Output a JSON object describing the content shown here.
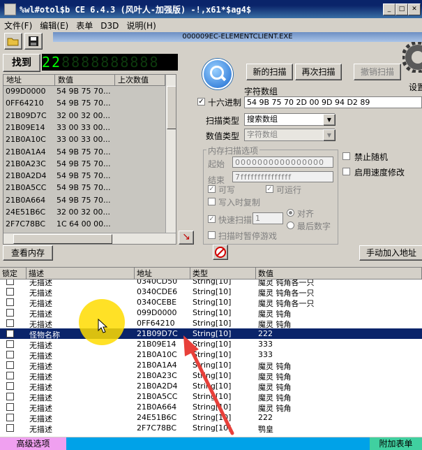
{
  "window": {
    "title": "%wl#otol$b  CE 6.4.3 (风叶人-加强版)  -!,x61*$ag4$"
  },
  "menu": [
    "文件(F)",
    "编辑(E)",
    "表单",
    "D3D",
    "说明(H)"
  ],
  "process": "000009EC-ELEMENTCLIENT.EXE",
  "found": {
    "label": "找到",
    "count": "22"
  },
  "found_headers": {
    "addr": "地址",
    "value": "数值",
    "prev": "上次数值"
  },
  "found_rows": [
    {
      "addr": "099D0000",
      "val": "54 9B 75 70..."
    },
    {
      "addr": "0FF64210",
      "val": "54 9B 75 70..."
    },
    {
      "addr": "21B09D7C",
      "val": "32 00 32 00..."
    },
    {
      "addr": "21B09E14",
      "val": "33 00 33 00..."
    },
    {
      "addr": "21B0A10C",
      "val": "33 00 33 00..."
    },
    {
      "addr": "21B0A1A4",
      "val": "54 9B 75 70..."
    },
    {
      "addr": "21B0A23C",
      "val": "54 9B 75 70..."
    },
    {
      "addr": "21B0A2D4",
      "val": "54 9B 75 70..."
    },
    {
      "addr": "21B0A5CC",
      "val": "54 9B 75 70..."
    },
    {
      "addr": "21B0A664",
      "val": "54 9B 75 70..."
    },
    {
      "addr": "24E51B6C",
      "val": "32 00 32 00..."
    },
    {
      "addr": "2F7C78BC",
      "val": "1C 64 00 00..."
    }
  ],
  "buttons": {
    "new_scan": "新的扫描",
    "next_scan": "再次扫描",
    "undo_scan": "撤销扫描",
    "settings": "设置",
    "view_memory": "查看内存",
    "add_manual": "手动加入地址"
  },
  "scan": {
    "hex_label": "十六进制",
    "value_label": "字符数组",
    "value": "54 9B 75 70 2D 00 9D 94 D2 89",
    "scan_type_label": "扫描类型",
    "scan_type": "搜索数组",
    "value_type_label": "数值类型",
    "value_type": "字符数组",
    "mem_options": "内存扫描选项",
    "start_label": "起始",
    "start": "0000000000000000",
    "end_label": "结束",
    "end": "7fffffffffffffff",
    "writable": "可写",
    "executable": "可运行",
    "copy_on_write": "写入时复制",
    "fast_scan": "快速扫描",
    "fast_value": "1",
    "align": "对齐",
    "last_digits": "最后数字",
    "pause": "扫描时暂停游戏",
    "no_random": "禁止随机",
    "speedhack": "启用速度修改"
  },
  "table_headers": {
    "lock": "锁定",
    "desc": "描述",
    "addr": "地址",
    "type": "类型",
    "value": "数值"
  },
  "table_rows": [
    {
      "desc": "无描述",
      "addr": "0340CD50",
      "type": "String[10]",
      "val": "魔灵 钝角各一只",
      "sel": false
    },
    {
      "desc": "无描述",
      "addr": "0340CDE6",
      "type": "String[10]",
      "val": "魔灵 钝角各一只",
      "sel": false
    },
    {
      "desc": "无描述",
      "addr": "0340CEBE",
      "type": "String[10]",
      "val": "魔灵 钝角各一只",
      "sel": false
    },
    {
      "desc": "无描述",
      "addr": "099D0000",
      "type": "String[10]",
      "val": "魔灵 钝角",
      "sel": false
    },
    {
      "desc": "无描述",
      "addr": "0FF64210",
      "type": "String[10]",
      "val": "魔灵 钝角",
      "sel": false
    },
    {
      "desc": "怪物名称",
      "addr": "21B09D7C",
      "type": "String[10]",
      "val": "222",
      "sel": true
    },
    {
      "desc": "无描述",
      "addr": "21B09E14",
      "type": "String[10]",
      "val": "333",
      "sel": false
    },
    {
      "desc": "无描述",
      "addr": "21B0A10C",
      "type": "String[10]",
      "val": "333",
      "sel": false
    },
    {
      "desc": "无描述",
      "addr": "21B0A1A4",
      "type": "String[10]",
      "val": "魔灵 钝角",
      "sel": false
    },
    {
      "desc": "无描述",
      "addr": "21B0A23C",
      "type": "String[10]",
      "val": "魔灵 钝角",
      "sel": false
    },
    {
      "desc": "无描述",
      "addr": "21B0A2D4",
      "type": "String[10]",
      "val": "魔灵 钝角",
      "sel": false
    },
    {
      "desc": "无描述",
      "addr": "21B0A5CC",
      "type": "String[10]",
      "val": "魔灵 钝角",
      "sel": false
    },
    {
      "desc": "无描述",
      "addr": "21B0A664",
      "type": "String[10]",
      "val": "魔灵 钝角",
      "sel": false
    },
    {
      "desc": "无描述",
      "addr": "24E51B6C",
      "type": "String[10]",
      "val": "222",
      "sel": false
    },
    {
      "desc": "无描述",
      "addr": "2F7C78BC",
      "type": "String[10]",
      "val": "鹗皇",
      "sel": false
    }
  ],
  "bottom": {
    "advanced": "高级选项",
    "append": "附加表单"
  }
}
